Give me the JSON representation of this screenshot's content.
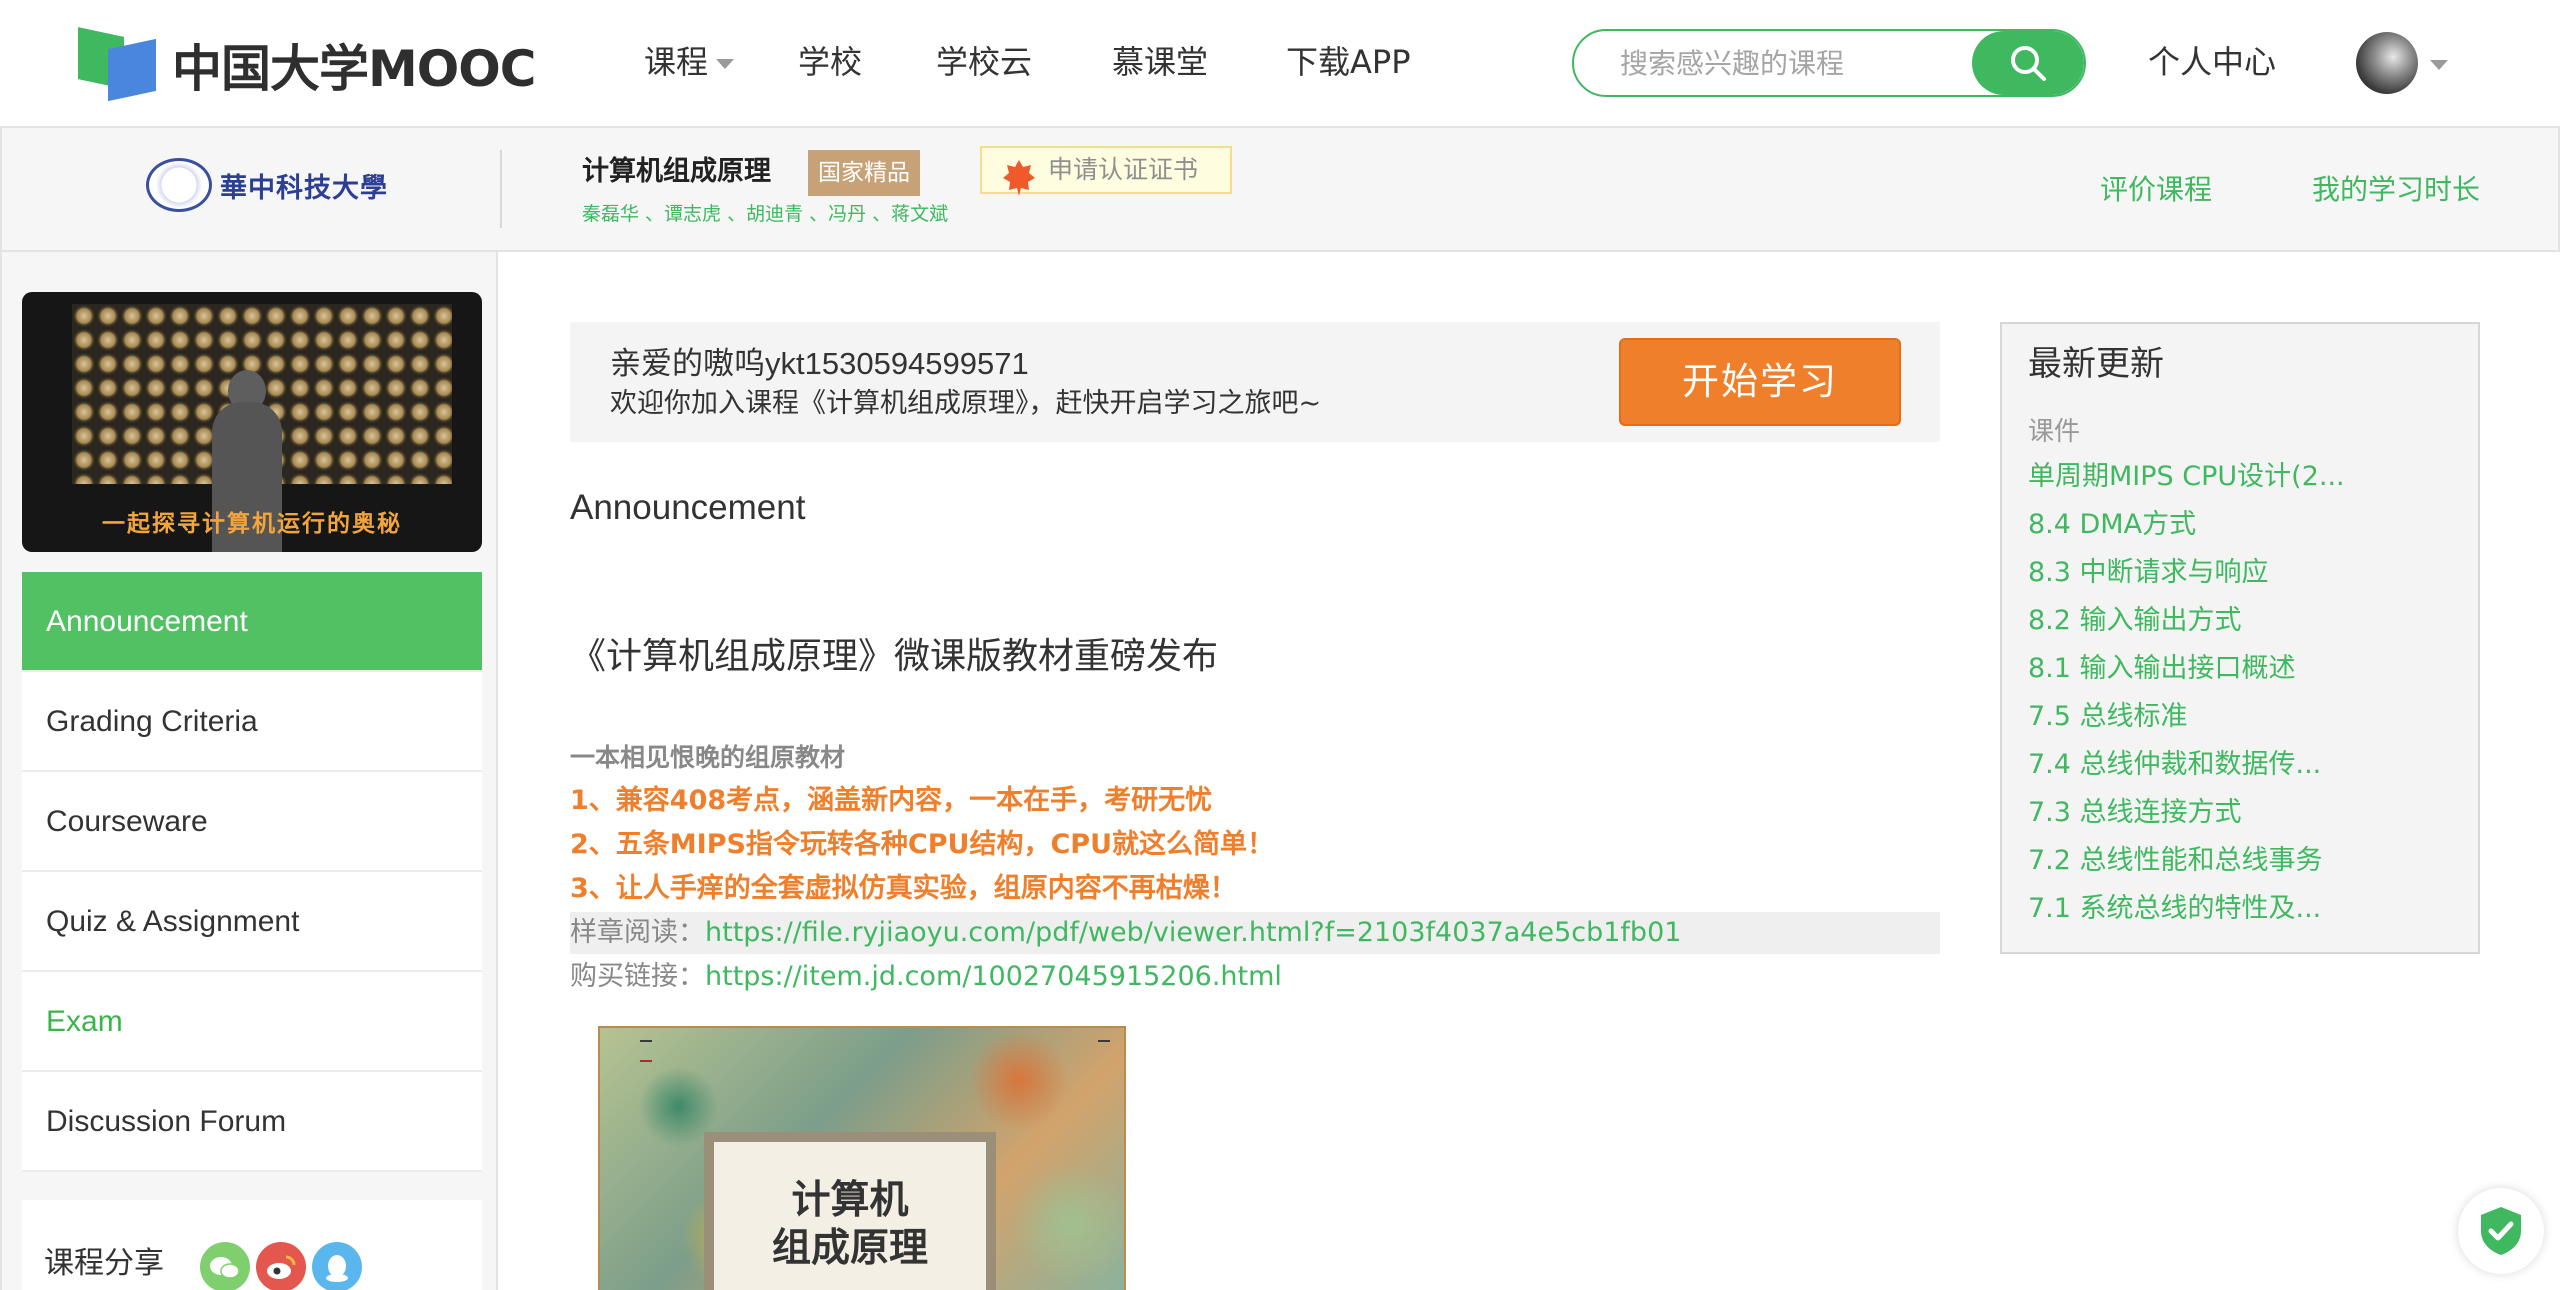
{
  "header": {
    "logo_text": "中国大学MOOC",
    "nav": [
      {
        "label": "课程"
      },
      {
        "label": "学校"
      },
      {
        "label": "学校云"
      },
      {
        "label": "慕课堂"
      },
      {
        "label": "下载APP"
      }
    ],
    "search": {
      "placeholder": "搜索感兴趣的课程"
    },
    "personal_center": "个人中心"
  },
  "course": {
    "school_name": "華中科技大學",
    "title": "计算机组成原理",
    "badge": "国家精品",
    "certificate_button": "申请认证证书",
    "teachers": "秦磊华 、谭志虎 、胡迪青 、冯丹 、蒋文斌",
    "links": {
      "rate": "评价课程",
      "study_time": "我的学习时长"
    }
  },
  "sidebar": {
    "banner_text": "一起探寻计算机运行的奥秘",
    "menu": [
      {
        "label": "Announcement"
      },
      {
        "label": "Grading Criteria"
      },
      {
        "label": "Courseware"
      },
      {
        "label": "Quiz & Assignment"
      },
      {
        "label": "Exam"
      },
      {
        "label": "Discussion Forum"
      }
    ],
    "share_label": "课程分享",
    "share_icons": [
      "wechat-icon",
      "weibo-icon",
      "qq-icon"
    ]
  },
  "welcome": {
    "name": "亲爱的嗷呜ykt1530594599571",
    "message": "欢迎你加入课程《计算机组成原理》，赶快开启学习之旅吧~",
    "start_button": "开始学习"
  },
  "announcement": {
    "section_title": "Announcement",
    "post_title": "《计算机组成原理》微课版教材重磅发布",
    "subtitle": "一本相见恨晚的组原教材",
    "points": [
      "1、兼容408考点，涵盖新内容，一本在手，考研无忧",
      "2、五条MIPS指令玩转各种CPU结构，CPU就这么简单！",
      "3、让人手痒的全套虚拟仿真实验，组原内容不再枯燥！"
    ],
    "sample_label": "样章阅读：",
    "sample_url": "https://file.ryjiaoyu.com/pdf/web/viewer.html?f=2103f4037a4e5cb1fb01",
    "buy_label": "购买链接：",
    "buy_url": "https://item.jd.com/10027045915206.html",
    "book": {
      "title_line1": "计算机",
      "title_line2": "组成原理"
    }
  },
  "updates": {
    "title": "最新更新",
    "category": "课件",
    "items": [
      "单周期MIPS CPU设计(2...",
      "8.4 DMA方式",
      "8.3 中断请求与响应",
      "8.2 输入输出方式",
      "8.1 输入输出接口概述",
      "7.5 总线标准",
      "7.4 总线仲裁和数据传...",
      "7.3 总线连接方式",
      "7.2 总线性能和总线事务",
      "7.1 系统总线的特性及..."
    ]
  },
  "colors": {
    "brand_green": "#3fb860",
    "active_menu": "#51c164",
    "start_orange": "#f07f2c",
    "badge_gold": "#c7a276"
  }
}
